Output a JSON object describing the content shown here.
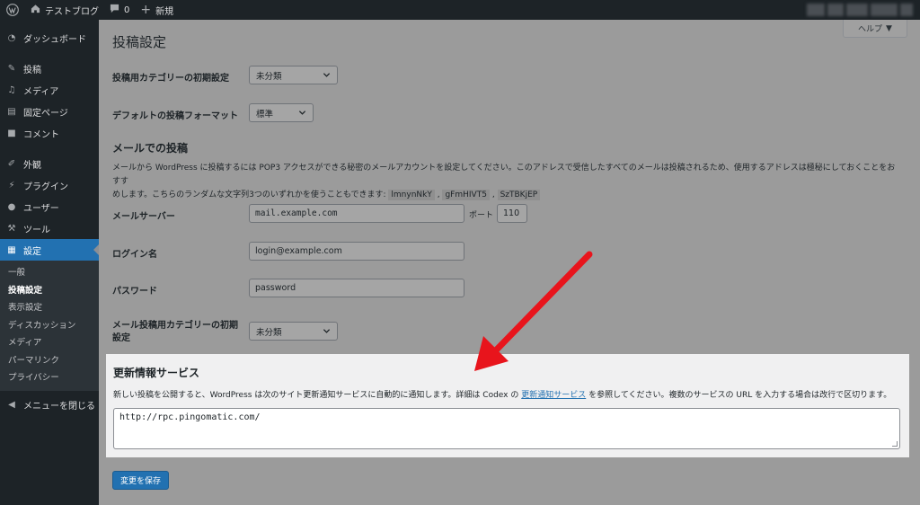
{
  "adminbar": {
    "site_name": "テストブログ",
    "comments_count": "0",
    "new_label": "新規"
  },
  "sidebar": {
    "items": [
      {
        "label": "ダッシュボード",
        "icon": "dashboard-icon"
      },
      {
        "label": "投稿",
        "icon": "pin-icon"
      },
      {
        "label": "メディア",
        "icon": "media-icon"
      },
      {
        "label": "固定ページ",
        "icon": "page-icon"
      },
      {
        "label": "コメント",
        "icon": "comment-icon"
      },
      {
        "label": "外観",
        "icon": "brush-icon"
      },
      {
        "label": "プラグイン",
        "icon": "plugin-icon"
      },
      {
        "label": "ユーザー",
        "icon": "user-icon"
      },
      {
        "label": "ツール",
        "icon": "wrench-icon"
      },
      {
        "label": "設定",
        "icon": "settings-icon"
      }
    ],
    "submenu": [
      "一般",
      "投稿設定",
      "表示設定",
      "ディスカッション",
      "メディア",
      "パーマリンク",
      "プライバシー"
    ],
    "collapse_label": "メニューを閉じる"
  },
  "page": {
    "title": "投稿設定",
    "help_label": "ヘルプ"
  },
  "form": {
    "default_category_label": "投稿用カテゴリーの初期設定",
    "default_category_value": "未分類",
    "default_format_label": "デフォルトの投稿フォーマット",
    "default_format_value": "標準",
    "mail_section_title": "メールでの投稿",
    "mail_desc_1": "メールから WordPress に投稿するには POP3 アクセスができる秘密のメールアカウントを設定してください。このアドレスで受信したすべてのメールは投稿されるため、使用するアドレスは極秘にしておくことをおすす",
    "mail_desc_2": "めします。こちらのランダムな文字列3つのいずれかを使うこともできます:",
    "random_strings": [
      "lmnynNkY",
      "gFmHIVT5",
      "SzTBKjEP"
    ],
    "separator": ",",
    "mail_server_label": "メールサーバー",
    "mail_server_value": "mail.example.com",
    "port_label": "ポート",
    "port_value": "110",
    "login_label": "ログイン名",
    "login_value": "login@example.com",
    "password_label": "パスワード",
    "password_value": "password",
    "mail_category_label_1": "メール投稿用カテゴリーの初期",
    "mail_category_label_2": "設定",
    "mail_category_value": "未分類"
  },
  "ping": {
    "title": "更新情報サービス",
    "desc_before": "新しい投稿を公開すると、WordPress は次のサイト更新通知サービスに自動的に通知します。詳細は Codex の ",
    "link_text": "更新通知サービス",
    "desc_after": " を参照してください。複数のサービスの URL を入力する場合は改行で区切ります。",
    "textarea_value": "http://rpc.pingomatic.com/"
  },
  "save_label": "変更を保存",
  "colors": {
    "admin_bg": "#1d2327",
    "accent": "#2271b1",
    "arrow": "#e8141c"
  }
}
